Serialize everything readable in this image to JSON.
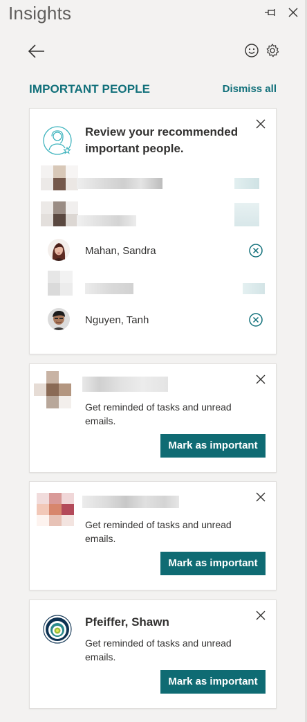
{
  "app": {
    "title": "Insights"
  },
  "section": {
    "title": "IMPORTANT PEOPLE",
    "dismiss_label": "Dismiss all"
  },
  "review_card": {
    "title": "Review your recommended important people.",
    "people": [
      {
        "name": "",
        "blurred": true
      },
      {
        "name": "",
        "blurred": true
      },
      {
        "name": "Mahan, Sandra",
        "blurred": false
      },
      {
        "name": "",
        "blurred": true
      },
      {
        "name": "Nguyen, Tanh",
        "blurred": false
      }
    ]
  },
  "suggestions": [
    {
      "name": "",
      "blurred": true,
      "description": "Get reminded of tasks and unread emails.",
      "button": "Mark as important"
    },
    {
      "name": "",
      "blurred": true,
      "description": "Get reminded of tasks and unread emails.",
      "button": "Mark as important"
    },
    {
      "name": "Pfeiffer, Shawn",
      "blurred": false,
      "description": "Get reminded of tasks and unread emails.",
      "button": "Mark as important"
    }
  ],
  "colors": {
    "accent": "#11707a",
    "button_bg": "#0f6b73",
    "text": "#323130",
    "background": "#f3f2f1"
  },
  "icons": [
    "pin-icon",
    "close-icon",
    "back-arrow-icon",
    "smiley-feedback-icon",
    "gear-icon",
    "people-star-icon",
    "remove-circle-icon"
  ]
}
